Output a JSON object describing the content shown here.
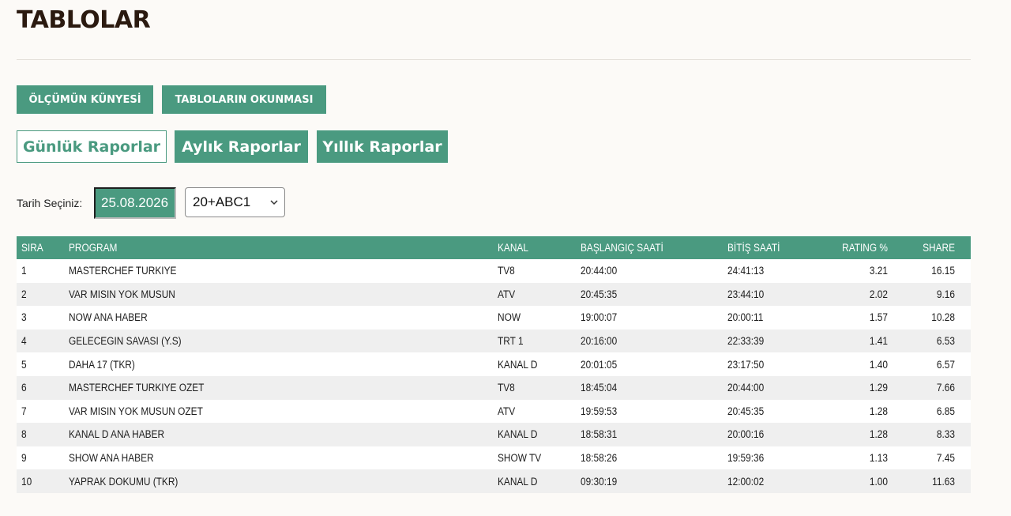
{
  "page": {
    "title": "TABLOLAR"
  },
  "buttons": {
    "olcum_kunyesi": "ÖLÇÜMÜN KÜNYESİ",
    "tablolarin_okunmasi": "TABLOLARIN OKUNMASI"
  },
  "report_tabs": [
    {
      "label": "Günlük Raporlar",
      "active": true
    },
    {
      "label": "Aylık Raporlar",
      "active": false
    },
    {
      "label": "Yıllık Raporlar",
      "active": false
    }
  ],
  "filter": {
    "date_label": "Tarih Seçiniz:",
    "date_value": "25.08.2026",
    "audience_selected": "20+ABC1"
  },
  "table": {
    "headers": {
      "sira": "SIRA",
      "program": "PROGRAM",
      "kanal": "KANAL",
      "baslangic": "BAŞLANGIÇ SAATİ",
      "bitis": "BİTİŞ SAATİ",
      "rating": "RATING %",
      "share": "SHARE"
    },
    "rows": [
      {
        "sira": "1",
        "program": "MASTERCHEF TURKIYE",
        "kanal": "TV8",
        "baslangic": "20:44:00",
        "bitis": "24:41:13",
        "rating": "3.21",
        "share": "16.15"
      },
      {
        "sira": "2",
        "program": "VAR MISIN YOK MUSUN",
        "kanal": "ATV",
        "baslangic": "20:45:35",
        "bitis": "23:44:10",
        "rating": "2.02",
        "share": "9.16"
      },
      {
        "sira": "3",
        "program": "NOW ANA HABER",
        "kanal": "NOW",
        "baslangic": "19:00:07",
        "bitis": "20:00:11",
        "rating": "1.57",
        "share": "10.28"
      },
      {
        "sira": "4",
        "program": "GELECEGIN SAVASI (Y.S)",
        "kanal": "TRT 1",
        "baslangic": "20:16:00",
        "bitis": "22:33:39",
        "rating": "1.41",
        "share": "6.53"
      },
      {
        "sira": "5",
        "program": "DAHA 17 (TKR)",
        "kanal": "KANAL D",
        "baslangic": "20:01:05",
        "bitis": "23:17:50",
        "rating": "1.40",
        "share": "6.57"
      },
      {
        "sira": "6",
        "program": "MASTERCHEF TURKIYE OZET",
        "kanal": "TV8",
        "baslangic": "18:45:04",
        "bitis": "20:44:00",
        "rating": "1.29",
        "share": "7.66"
      },
      {
        "sira": "7",
        "program": "VAR MISIN YOK MUSUN OZET",
        "kanal": "ATV",
        "baslangic": "19:59:53",
        "bitis": "20:45:35",
        "rating": "1.28",
        "share": "6.85"
      },
      {
        "sira": "8",
        "program": "KANAL D ANA HABER",
        "kanal": "KANAL D",
        "baslangic": "18:58:31",
        "bitis": "20:00:16",
        "rating": "1.28",
        "share": "8.33"
      },
      {
        "sira": "9",
        "program": "SHOW ANA HABER",
        "kanal": "SHOW TV",
        "baslangic": "18:58:26",
        "bitis": "19:59:36",
        "rating": "1.13",
        "share": "7.45"
      },
      {
        "sira": "10",
        "program": "YAPRAK DOKUMU (TKR)",
        "kanal": "KANAL D",
        "baslangic": "09:30:19",
        "bitis": "12:00:02",
        "rating": "1.00",
        "share": "11.63"
      }
    ]
  },
  "colors": {
    "accent": "#4a9a80",
    "title": "#2b1a10",
    "row_alt": "#efefef"
  },
  "icons": {
    "select_arrow": "chevron-down-icon"
  }
}
